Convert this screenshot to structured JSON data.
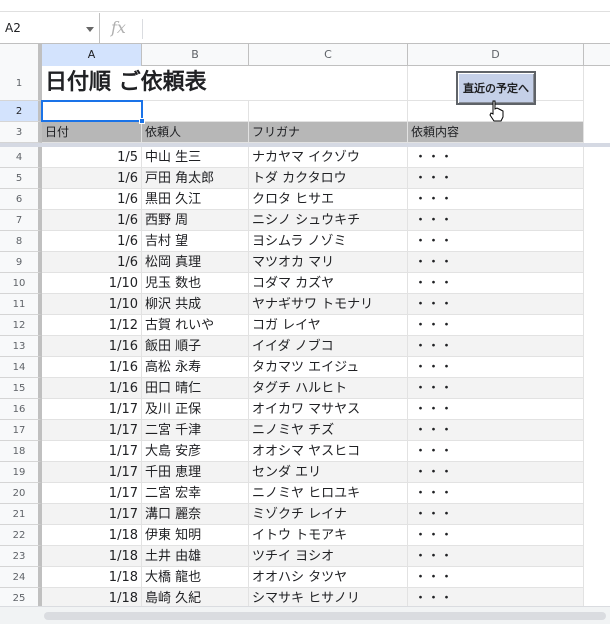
{
  "name_box": {
    "value": "A2"
  },
  "formula_bar": {
    "fx_icon": "fx"
  },
  "columns": [
    {
      "letter": "A",
      "selected": true
    },
    {
      "letter": "B",
      "selected": false
    },
    {
      "letter": "C",
      "selected": false
    },
    {
      "letter": "D",
      "selected": false
    }
  ],
  "sheet": {
    "title": "日付順 ご依頼表",
    "button_label": "直近の予定へ",
    "headers": {
      "date": "日付",
      "requester": "依頼人",
      "furigana": "フリガナ",
      "content": "依頼内容"
    },
    "rows": [
      {
        "num": "4",
        "date": "1/5",
        "name": "中山 生三",
        "kana": "ナカヤマ イクゾウ",
        "content": "・・・"
      },
      {
        "num": "5",
        "date": "1/6",
        "name": "戸田 角太郎",
        "kana": "トダ カクタロウ",
        "content": "・・・"
      },
      {
        "num": "6",
        "date": "1/6",
        "name": "黒田 久江",
        "kana": "クロタ ヒサエ",
        "content": "・・・"
      },
      {
        "num": "7",
        "date": "1/6",
        "name": "西野 周",
        "kana": "ニシノ シュウキチ",
        "content": "・・・"
      },
      {
        "num": "8",
        "date": "1/6",
        "name": "吉村 望",
        "kana": "ヨシムラ ノゾミ",
        "content": "・・・"
      },
      {
        "num": "9",
        "date": "1/6",
        "name": "松岡 真理",
        "kana": "マツオカ マリ",
        "content": "・・・"
      },
      {
        "num": "10",
        "date": "1/10",
        "name": "児玉 数也",
        "kana": "コダマ カズヤ",
        "content": "・・・"
      },
      {
        "num": "11",
        "date": "1/10",
        "name": "柳沢 共成",
        "kana": "ヤナギサワ トモナリ",
        "content": "・・・"
      },
      {
        "num": "12",
        "date": "1/12",
        "name": "古賀 れいや",
        "kana": "コガ レイヤ",
        "content": "・・・"
      },
      {
        "num": "13",
        "date": "1/16",
        "name": "飯田 順子",
        "kana": "イイダ ノブコ",
        "content": "・・・"
      },
      {
        "num": "14",
        "date": "1/16",
        "name": "高松 永寿",
        "kana": "タカマツ エイジュ",
        "content": "・・・"
      },
      {
        "num": "15",
        "date": "1/16",
        "name": "田口 晴仁",
        "kana": "タグチ ハルヒト",
        "content": "・・・"
      },
      {
        "num": "16",
        "date": "1/17",
        "name": "及川 正保",
        "kana": "オイカワ マサヤス",
        "content": "・・・"
      },
      {
        "num": "17",
        "date": "1/17",
        "name": "二宮 千津",
        "kana": "ニノミヤ チズ",
        "content": "・・・"
      },
      {
        "num": "18",
        "date": "1/17",
        "name": "大島 安彦",
        "kana": "オオシマ ヤスヒコ",
        "content": "・・・"
      },
      {
        "num": "19",
        "date": "1/17",
        "name": "千田 恵理",
        "kana": "センダ エリ",
        "content": "・・・"
      },
      {
        "num": "20",
        "date": "1/17",
        "name": "二宮 宏幸",
        "kana": "ニノミヤ ヒロユキ",
        "content": "・・・"
      },
      {
        "num": "21",
        "date": "1/17",
        "name": "溝口 麗奈",
        "kana": "ミゾクチ レイナ",
        "content": "・・・"
      },
      {
        "num": "22",
        "date": "1/18",
        "name": "伊東 知明",
        "kana": "イトウ トモアキ",
        "content": "・・・"
      },
      {
        "num": "23",
        "date": "1/18",
        "name": "土井 由雄",
        "kana": "ツチイ ヨシオ",
        "content": "・・・"
      },
      {
        "num": "24",
        "date": "1/18",
        "name": "大橋 龍也",
        "kana": "オオハシ タツヤ",
        "content": "・・・"
      },
      {
        "num": "25",
        "date": "1/18",
        "name": "島崎 久紀",
        "kana": "シマサキ ヒサノリ",
        "content": "・・・"
      }
    ]
  },
  "row_numbers_top": [
    "1",
    "2",
    "3"
  ]
}
